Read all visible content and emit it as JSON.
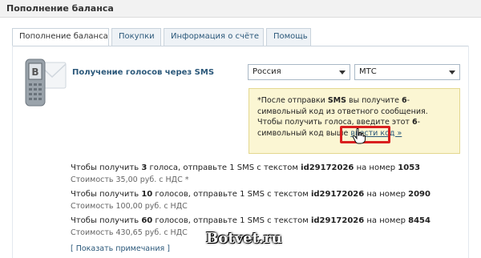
{
  "header": {
    "title": "Пополнение баланса"
  },
  "tabs": [
    {
      "label": "Пополнение баланса"
    },
    {
      "label": "Покупки"
    },
    {
      "label": "Информация о счёте"
    },
    {
      "label": "Помощь"
    }
  ],
  "sms": {
    "title": "Получение голосов через SMS",
    "country": "Россия",
    "operator": "МТС"
  },
  "notice": {
    "p1": "*После отправки ",
    "p2": "SMS",
    "p3": " вы получите ",
    "p4": "6",
    "p5": "-символьный код из ответного сообщения.",
    "p6": "Чтобы получить голоса, введите этот ",
    "p7": "6",
    "p8": "-символьный код выше",
    "link": "ввести код »"
  },
  "offers": [
    {
      "a": "Чтобы получить ",
      "votes": "3",
      "b": " голоса, отправьте 1 SMS с текстом ",
      "code": "id29172026",
      "c": " на номер ",
      "number": "1053",
      "cost": "Стоимость 35,00 руб. с НДС *"
    },
    {
      "a": "Чтобы получить ",
      "votes": "10",
      "b": " голосов, отправьте 1 SMS с текстом ",
      "code": "id29172026",
      "c": " на номер ",
      "number": "2090",
      "cost": "Стоимость 100,00 руб. с НДС"
    },
    {
      "a": "Чтобы получить ",
      "votes": "60",
      "b": " голосов, отправьте 1 SMS с текстом ",
      "code": "id29172026",
      "c": " на номер ",
      "number": "8454",
      "cost": "Стоимость 430,65 руб. с НДС"
    }
  ],
  "show_notes": "[ Показать примечания ]",
  "watermark": "Botvet.ru"
}
